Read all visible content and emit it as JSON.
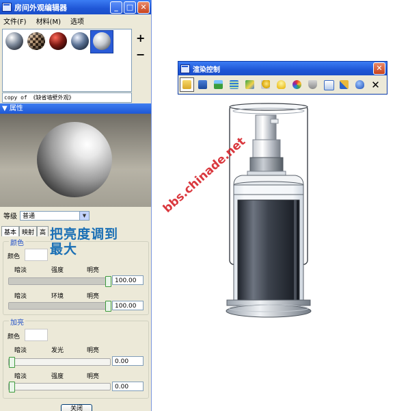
{
  "editor": {
    "title": "房间外观编辑器",
    "menu": [
      "文件(F)",
      "材料(M)",
      "选项"
    ],
    "plus": "+",
    "minus": "−",
    "copy_of": "copy of 《缺省墙壁外观》",
    "section": "属性",
    "level_label": "等级",
    "level_value": "普通",
    "tabs": [
      "基本",
      "映射",
      "高"
    ],
    "color_group": {
      "legend": "颜色",
      "color_label": "颜色",
      "slider1": {
        "left": "暗淡",
        "mid": "强度",
        "right": "明亮",
        "value": "100.00",
        "level": 1.0
      },
      "slider2": {
        "left": "暗淡",
        "mid": "环境",
        "right": "明亮",
        "value": "100.00",
        "level": 1.0
      }
    },
    "highlight_group": {
      "legend": "加亮",
      "color_label": "颜色",
      "slider1": {
        "left": "暗淡",
        "mid": "发光",
        "right": "明亮",
        "value": "0.00",
        "level": 0.0
      },
      "slider2": {
        "left": "暗淡",
        "mid": "强度",
        "right": "明亮",
        "value": "0.00",
        "level": 0.0
      }
    },
    "close_button": "关闭"
  },
  "annotation": [
    "把亮度调到",
    "最大"
  ],
  "render_control": {
    "title": "渲染控制",
    "tools": [
      "open-folder-icon",
      "save-icon",
      "landscape-icon",
      "lines-icon",
      "map-icon",
      "light-icon",
      "bulb-icon",
      "color-wheel-icon",
      "shield-icon",
      "export-icon",
      "settings-icon",
      "teapot-icon",
      "close-x-icon"
    ],
    "close_glyph": "✕"
  },
  "watermark": "bbs.chinade.net",
  "colors": {
    "accent": "#1f56d6",
    "annotation": "#1a6fb5",
    "watermark": "#d7232a",
    "slider_thumb": "#3e9a3e"
  }
}
